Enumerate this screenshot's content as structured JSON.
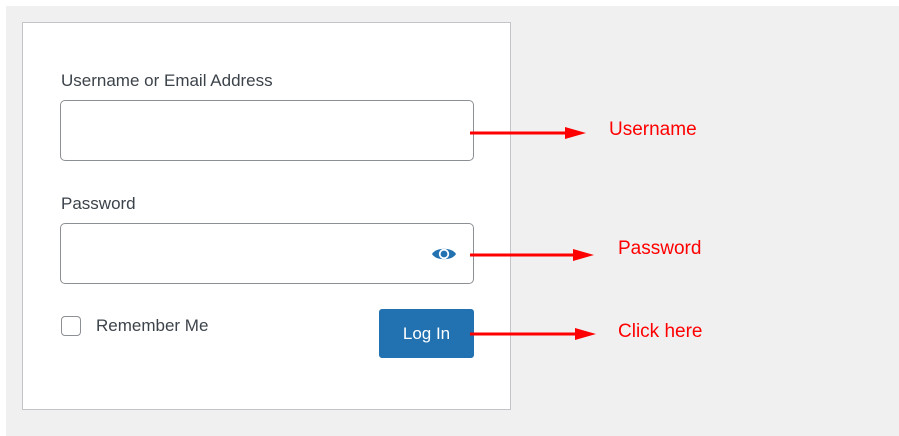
{
  "login_form": {
    "username_label": "Username or Email Address",
    "username_value": "",
    "password_label": "Password",
    "password_value": "",
    "show_password_icon": "eye-icon",
    "remember_label": "Remember Me",
    "remember_checked": false,
    "login_button_label": "Log In"
  },
  "annotations": {
    "username": "Username",
    "password": "Password",
    "click_here": "Click here"
  },
  "colors": {
    "page_background": "#f0f0f1",
    "primary_button": "#2271b1",
    "annotation": "#ff0000",
    "eye_icon": "#2271b1"
  }
}
